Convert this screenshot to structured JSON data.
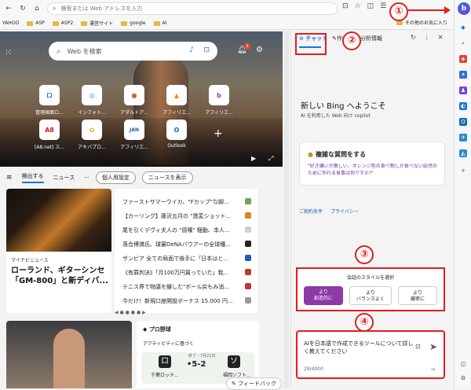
{
  "browser": {
    "address_placeholder": "検索または Web アドレスを入力"
  },
  "favorites": {
    "items": [
      "YAHOO",
      "ASP",
      "ASP2",
      "運営サイト",
      "google",
      "AI"
    ],
    "other": "その他のお気に入り"
  },
  "newtab": {
    "search_placeholder": "Web を検索",
    "bell_badge": "1",
    "tiles": [
      "管理画面ロ...",
      "インフォト...",
      "アダルトア...",
      "アフィリエ...",
      "アフィリエ...",
      "[A8.net] ス...",
      "アキバプロ...",
      "アフィリエ...",
      "Outlook"
    ],
    "tile_marks": [
      "ロ",
      "◎",
      "●",
      "▲",
      "b",
      "A8",
      "✿",
      "JAN",
      "O"
    ],
    "feed_tabs": {
      "tab1": "検出する",
      "tab2": "ニュース",
      "dots": "···",
      "personal": "個人用設定",
      "show_news": "ニュースを表示"
    },
    "news_source": "マイナビニュース",
    "headline": "ローランド、ギターシンセ「GM-800」と新ディバ...",
    "news_list": [
      "ファーストサマーウイカ、\"Fカップ\"な脚...",
      "【カーリング】藤沢五月の \"激変ショット...",
      "尾を引くデヴィ夫人の \"感嘆\" 騒動、本人...",
      "落合博満氏、球審DeNAバウアーの全球種...",
      "ザンビア 全ての局面で後手に「日本はと...",
      "《有罪判決》「月100万円貰っていた」我...",
      "テニス界で物議を醸した\"ボール戻もみ消...",
      "今だけ！新規口座開設ボーナス 15.000 円..."
    ],
    "pro_title": "プロ野球",
    "pro_sub": "アクティビティに基づく",
    "score": "•5-2",
    "score_meta": "終了・7月22日",
    "team1": "ロ",
    "team2": "ソ",
    "team1_name": "千葉ロッテ...",
    "team2_name": "福岡ソフト...",
    "feedback": "フィードバック"
  },
  "sidebar": {
    "tab_chat": "チャット",
    "tab_compose": "作成",
    "tab_insight": "分析情報",
    "welcome": "新しい Bing へようこそ",
    "welcome_sub": "AI を利用した Web 向け copilot",
    "card_title": "複雑な質問をする",
    "card_body": "\"好き嫌いが激しい、オレンジ色の食べ物しか食べない幼児のために作れる食事は何ですか?\"",
    "link_terms": "ご契約条件",
    "link_privacy": "プライバシー",
    "style_title": "会話のスタイルを選択",
    "style_buttons": [
      {
        "top": "より",
        "main": "創造的に"
      },
      {
        "top": "より",
        "main": "バランスよく"
      },
      {
        "top": "より",
        "main": "厳密に"
      }
    ],
    "input_text": "AIを日本語で作成できるツールについて詳しく教えてください",
    "counter": "29/4000"
  },
  "annotations": {
    "n1": "①",
    "n2": "②",
    "n3": "③",
    "n4": "④"
  },
  "colors": {
    "accent": "#1a73e8",
    "annotation": "#e01e1e",
    "bing_purple": "#8b3aa6"
  }
}
